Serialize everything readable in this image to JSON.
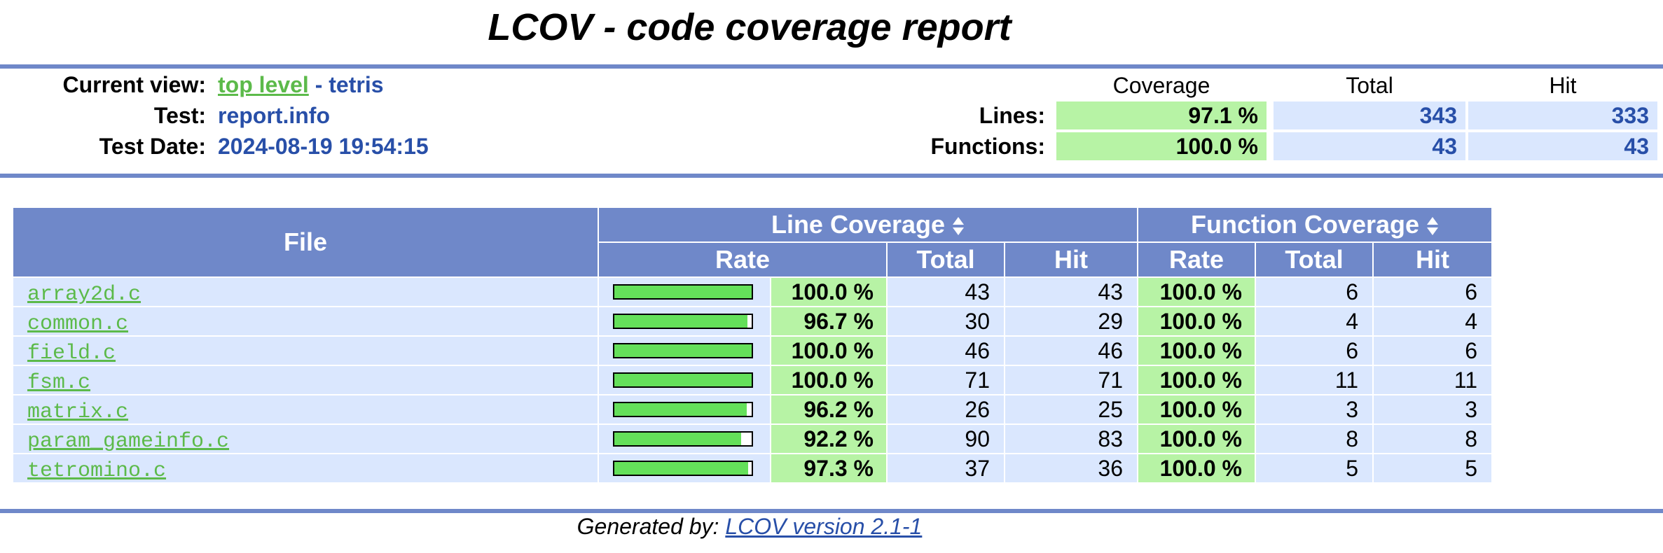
{
  "title": "LCOV - code coverage report",
  "header": {
    "current_view_label": "Current view:",
    "current_view_link": "top level",
    "current_view_sep": " - ",
    "current_view_name": "tetris",
    "test_label": "Test:",
    "test_value": "report.info",
    "date_label": "Test Date:",
    "date_value": "2024-08-19 19:54:15"
  },
  "summary": {
    "col_coverage": "Coverage",
    "col_total": "Total",
    "col_hit": "Hit",
    "rows": [
      {
        "label": "Lines:",
        "coverage": "97.1 %",
        "total": "343",
        "hit": "333"
      },
      {
        "label": "Functions:",
        "coverage": "100.0 %",
        "total": "43",
        "hit": "43"
      }
    ]
  },
  "table": {
    "file_header": "File",
    "line_coverage_header": "Line Coverage",
    "function_coverage_header": "Function Coverage",
    "rate": "Rate",
    "total": "Total",
    "hit": "Hit",
    "rows": [
      {
        "file": "array2d.c",
        "line_pct": "100.0 %",
        "line_fraction": 1.0,
        "line_total": "43",
        "line_hit": "43",
        "func_pct": "100.0 %",
        "func_total": "6",
        "func_hit": "6"
      },
      {
        "file": "common.c",
        "line_pct": "96.7 %",
        "line_fraction": 0.967,
        "line_total": "30",
        "line_hit": "29",
        "func_pct": "100.0 %",
        "func_total": "4",
        "func_hit": "4"
      },
      {
        "file": "field.c",
        "line_pct": "100.0 %",
        "line_fraction": 1.0,
        "line_total": "46",
        "line_hit": "46",
        "func_pct": "100.0 %",
        "func_total": "6",
        "func_hit": "6"
      },
      {
        "file": "fsm.c",
        "line_pct": "100.0 %",
        "line_fraction": 1.0,
        "line_total": "71",
        "line_hit": "71",
        "func_pct": "100.0 %",
        "func_total": "11",
        "func_hit": "11"
      },
      {
        "file": "matrix.c",
        "line_pct": "96.2 %",
        "line_fraction": 0.962,
        "line_total": "26",
        "line_hit": "25",
        "func_pct": "100.0 %",
        "func_total": "3",
        "func_hit": "3"
      },
      {
        "file": "param_gameinfo.c",
        "line_pct": "92.2 %",
        "line_fraction": 0.922,
        "line_total": "90",
        "line_hit": "83",
        "func_pct": "100.0 %",
        "func_total": "8",
        "func_hit": "8"
      },
      {
        "file": "tetromino.c",
        "line_pct": "97.3 %",
        "line_fraction": 0.973,
        "line_total": "37",
        "line_hit": "36",
        "func_pct": "100.0 %",
        "func_total": "5",
        "func_hit": "5"
      }
    ]
  },
  "footer": {
    "prefix": "Generated by: ",
    "link": "LCOV version 2.1-1"
  },
  "colors": {
    "header_blue": "#6f88c9",
    "cell_blue": "#dae7fe",
    "cell_green": "#b7f3a5",
    "bar_green": "#64e05a",
    "link_green": "#5cba4a",
    "text_blue": "#284fa8"
  }
}
